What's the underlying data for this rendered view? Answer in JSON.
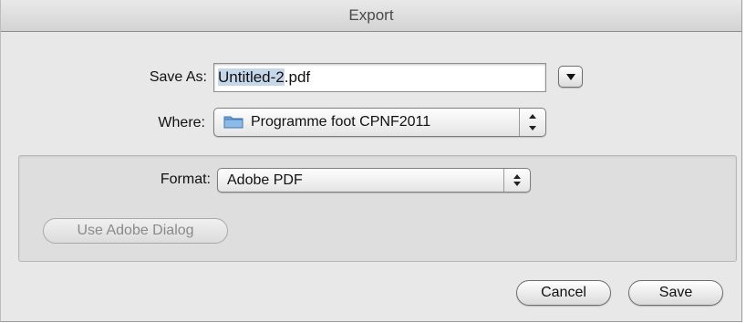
{
  "window": {
    "title": "Export"
  },
  "save_as": {
    "label": "Save As:",
    "value_selected": "Untitled-2",
    "value_ext": ".pdf"
  },
  "where": {
    "label": "Where:",
    "folder": "Programme foot CPNF2011",
    "folder_icon": "folder-icon"
  },
  "format": {
    "label": "Format:",
    "value": "Adobe PDF"
  },
  "buttons": {
    "use_adobe_dialog": "Use Adobe Dialog",
    "cancel": "Cancel",
    "save": "Save"
  },
  "colors": {
    "folder": "#6fa6db",
    "selection": "#c7d7ea"
  }
}
